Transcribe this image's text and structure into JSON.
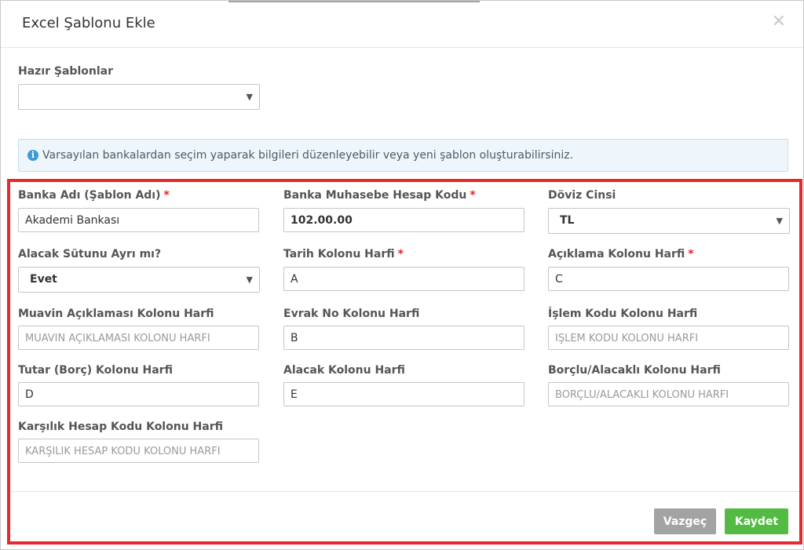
{
  "modal": {
    "title": "Excel Şablonu Ekle",
    "close_symbol": "×"
  },
  "templates": {
    "label": "Hazır Şablonlar",
    "selected": "",
    "caret": "▼"
  },
  "info": {
    "icon": "i",
    "text": "Varsayılan bankalardan seçim yaparak bilgileri düzenleyebilir veya yeni şablon oluşturabilirsiniz."
  },
  "required_marker": "*",
  "form": {
    "bank_name": {
      "label": "Banka Adı (Şablon Adı)",
      "value": "Akademi Bankası",
      "placeholder": ""
    },
    "account_code": {
      "label": "Banka Muhasebe Hesap Kodu",
      "value": "102.00.00",
      "placeholder": ""
    },
    "currency": {
      "label": "Döviz Cinsi",
      "value": "TL"
    },
    "credit_separate": {
      "label": "Alacak Sütunu Ayrı mı?",
      "value": "Evet"
    },
    "date_col": {
      "label": "Tarih Kolonu Harfi",
      "value": "A",
      "placeholder": ""
    },
    "desc_col": {
      "label": "Açıklama Kolonu Harfi",
      "value": "C",
      "placeholder": ""
    },
    "aux_desc_col": {
      "label": "Muavin Açıklaması Kolonu Harfi",
      "value": "",
      "placeholder": "MUAVİN AÇIKLAMASI KOLONU HARFİ"
    },
    "doc_no_col": {
      "label": "Evrak No Kolonu Harfi",
      "value": "B",
      "placeholder": ""
    },
    "txn_code_col": {
      "label": "İşlem Kodu Kolonu Harfi",
      "value": "",
      "placeholder": "İŞLEM KODU KOLONU HARFİ"
    },
    "amount_col": {
      "label": "Tutar (Borç) Kolonu Harfi",
      "value": "D",
      "placeholder": ""
    },
    "credit_col": {
      "label": "Alacak Kolonu Harfi",
      "value": "E",
      "placeholder": ""
    },
    "debit_credit_col": {
      "label": "Borçlu/Alacaklı Kolonu Harfi",
      "value": "",
      "placeholder": "BORÇLU/ALACAKLI KOLONU HARFİ"
    },
    "counter_acct_col": {
      "label": "Karşılık Hesap Kodu Kolonu Harfi",
      "value": "",
      "placeholder": "KARŞILIK HESAP KODU KOLONU HARFİ"
    }
  },
  "buttons": {
    "cancel": "Vazgeç",
    "save": "Kaydet"
  },
  "colors": {
    "highlight_border": "#e32a2f",
    "save_button": "#53bb43",
    "cancel_button": "#a3a3a3",
    "info_icon": "#3b9bd8",
    "required": "#e02424"
  }
}
